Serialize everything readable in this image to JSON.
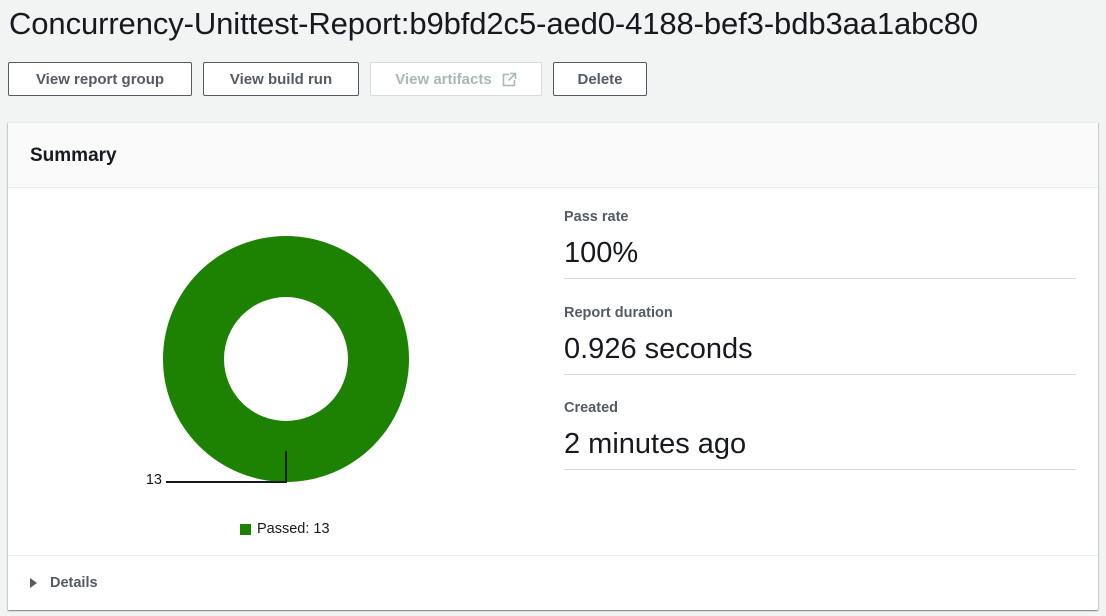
{
  "page": {
    "title": "Concurrency-Unittest-Report:b9bfd2c5-aed0-4188-bef3-bdb3aa1abc80"
  },
  "actions": {
    "view_report_group": "View report group",
    "view_build_run": "View build run",
    "view_artifacts": "View artifacts",
    "view_artifacts_icon": "external-link-icon",
    "delete": "Delete"
  },
  "summary": {
    "title": "Summary",
    "metrics": [
      {
        "label": "Pass rate",
        "value": "100%"
      },
      {
        "label": "Report duration",
        "value": "0.926 seconds"
      },
      {
        "label": "Created",
        "value": "2 minutes ago"
      }
    ],
    "details_label": "Details"
  },
  "chart_data": {
    "type": "pie",
    "donut": true,
    "categories": [
      "Passed"
    ],
    "values": [
      13
    ],
    "colors": [
      "#1d8102"
    ],
    "slice_labels": [
      "13"
    ],
    "legend": [
      {
        "name": "Passed: 13",
        "color": "#1d8102"
      }
    ],
    "legend_position": "bottom"
  }
}
